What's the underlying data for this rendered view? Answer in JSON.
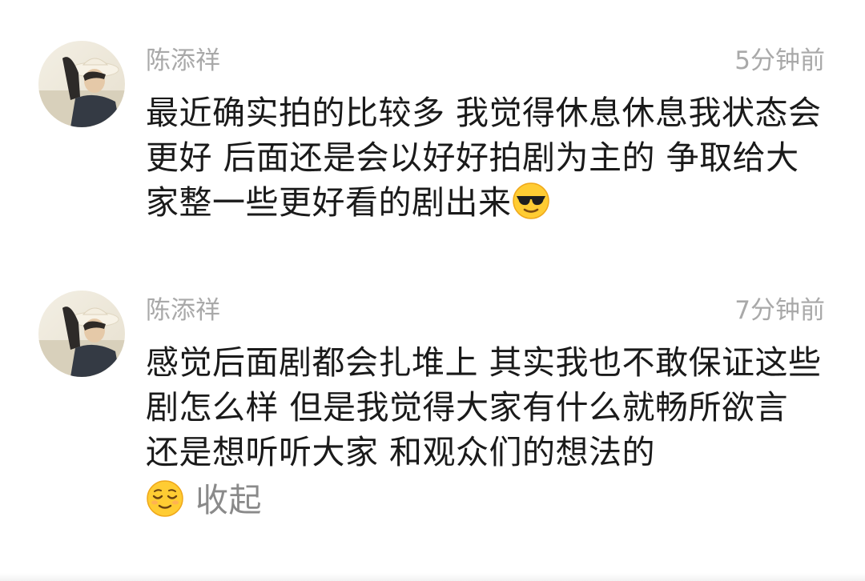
{
  "comments": [
    {
      "username": "陈添祥",
      "time": "5分钟前",
      "text": "最近确实拍的比较多 我觉得休息休息我状态会更好 后面还是会以好好拍剧为主的 争取给大家整一些更好看的剧出来",
      "emoji": "sunglasses-face-emoji"
    },
    {
      "username": "陈添祥",
      "time": "7分钟前",
      "text": "感觉后面剧都会扎堆上 其实我也不敢保证这些剧怎么样 但是我觉得大家有什么就畅所欲言 还是想听听大家 和观众们的想法的",
      "emoji": "relieved-face-emoji",
      "collapse_label": "收起"
    }
  ],
  "colors": {
    "meta_text": "#a9a9a9",
    "body_text": "#1a1a1a",
    "link_text": "#8a8a8a"
  }
}
